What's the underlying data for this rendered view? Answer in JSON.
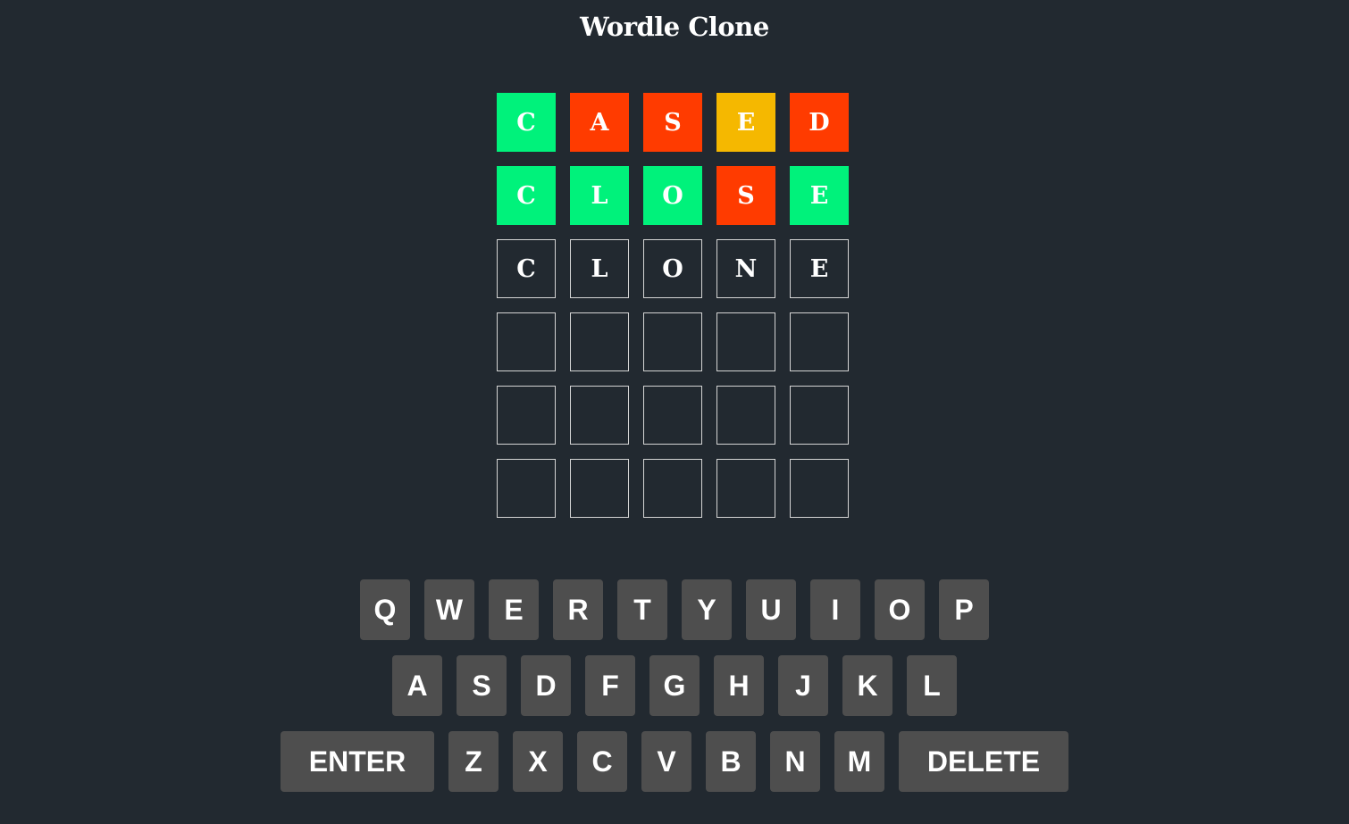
{
  "app": {
    "title": "Wordle Clone"
  },
  "colors": {
    "correct": "#00f27b",
    "present": "#f5b800",
    "absent": "#ff3b00",
    "empty": "#222930",
    "border": "#d4d4d4",
    "key": "#4e4e4e"
  },
  "board": {
    "rows": [
      [
        {
          "letter": "C",
          "state": "correct"
        },
        {
          "letter": "A",
          "state": "absent"
        },
        {
          "letter": "S",
          "state": "absent"
        },
        {
          "letter": "E",
          "state": "present"
        },
        {
          "letter": "D",
          "state": "absent"
        }
      ],
      [
        {
          "letter": "C",
          "state": "correct"
        },
        {
          "letter": "L",
          "state": "correct"
        },
        {
          "letter": "O",
          "state": "correct"
        },
        {
          "letter": "S",
          "state": "absent"
        },
        {
          "letter": "E",
          "state": "correct"
        }
      ],
      [
        {
          "letter": "C",
          "state": "empty"
        },
        {
          "letter": "L",
          "state": "empty"
        },
        {
          "letter": "O",
          "state": "empty"
        },
        {
          "letter": "N",
          "state": "empty"
        },
        {
          "letter": "E",
          "state": "empty"
        }
      ],
      [
        {
          "letter": "",
          "state": "empty"
        },
        {
          "letter": "",
          "state": "empty"
        },
        {
          "letter": "",
          "state": "empty"
        },
        {
          "letter": "",
          "state": "empty"
        },
        {
          "letter": "",
          "state": "empty"
        }
      ],
      [
        {
          "letter": "",
          "state": "empty"
        },
        {
          "letter": "",
          "state": "empty"
        },
        {
          "letter": "",
          "state": "empty"
        },
        {
          "letter": "",
          "state": "empty"
        },
        {
          "letter": "",
          "state": "empty"
        }
      ],
      [
        {
          "letter": "",
          "state": "empty"
        },
        {
          "letter": "",
          "state": "empty"
        },
        {
          "letter": "",
          "state": "empty"
        },
        {
          "letter": "",
          "state": "empty"
        },
        {
          "letter": "",
          "state": "empty"
        }
      ]
    ]
  },
  "keyboard": {
    "rows": [
      [
        "Q",
        "W",
        "E",
        "R",
        "T",
        "Y",
        "U",
        "I",
        "O",
        "P"
      ],
      [
        "A",
        "S",
        "D",
        "F",
        "G",
        "H",
        "J",
        "K",
        "L"
      ],
      [
        "ENTER",
        "Z",
        "X",
        "C",
        "V",
        "B",
        "N",
        "M",
        "DELETE"
      ]
    ]
  }
}
